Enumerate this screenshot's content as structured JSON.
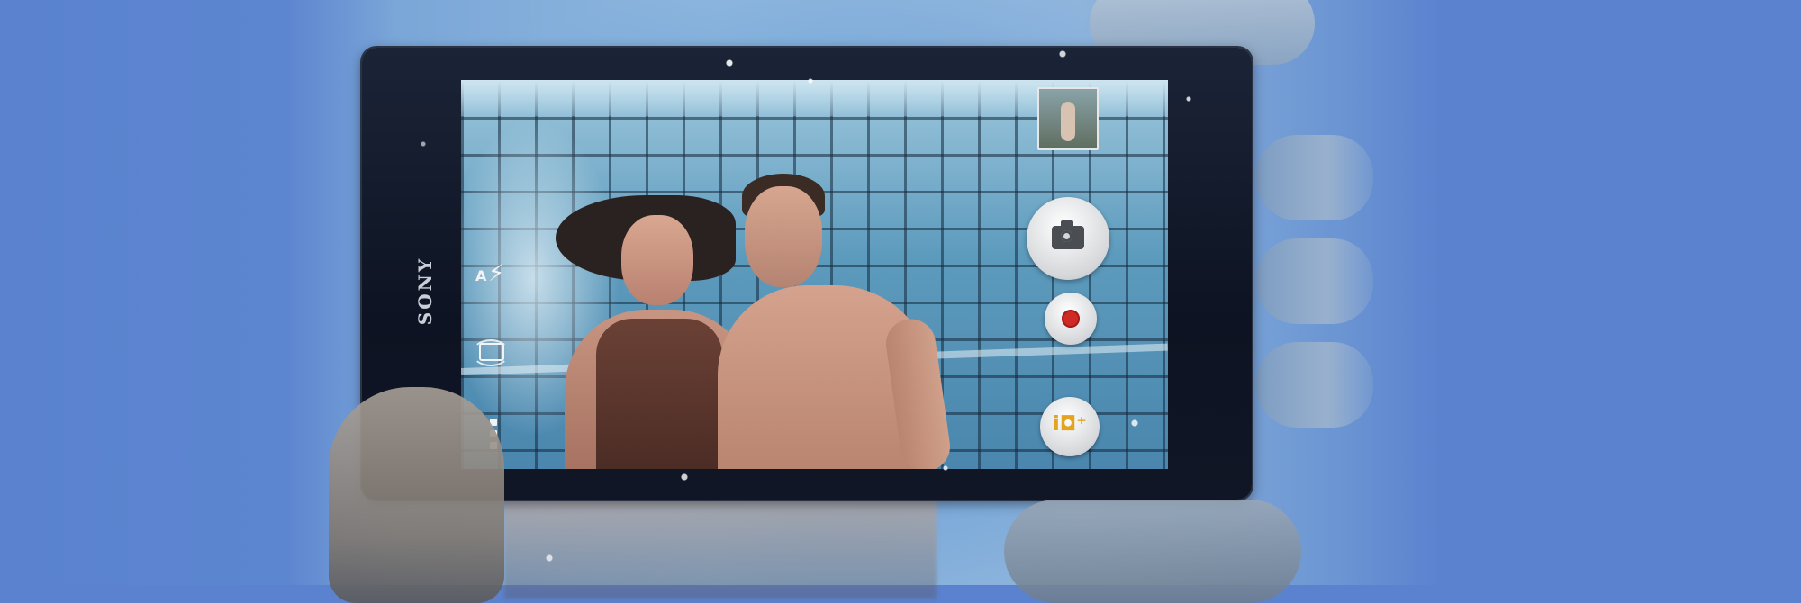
{
  "phone": {
    "brand_logo": "SONY"
  },
  "camera_ui": {
    "flash": {
      "mode_letter": "A",
      "icon": "flash-auto-icon"
    },
    "switch_camera": {
      "icon": "switch-camera-icon"
    },
    "menu": {
      "icon": "more-vertical-icon"
    },
    "thumbnail": {
      "icon": "last-photo-thumbnail"
    },
    "shutter": {
      "icon": "camera-icon"
    },
    "record": {
      "icon": "record-icon",
      "color": "#cf2a25"
    },
    "superior_auto": {
      "icon": "superior-auto-camera-icon",
      "color": "#e3a521"
    }
  },
  "colors": {
    "background": "#5b82ce",
    "phone_body": "#0d1322"
  }
}
